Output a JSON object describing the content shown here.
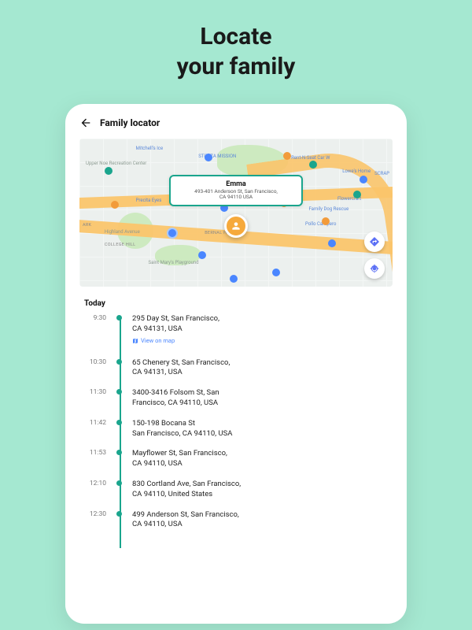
{
  "promo": {
    "line1": "Locate",
    "line2": "your family"
  },
  "header": {
    "title": "Family locator"
  },
  "map": {
    "callout": {
      "name": "Emma",
      "address_line1": "493-401 Anderson St, San Francisco,",
      "address_line2": "CA 94110 USA"
    },
    "labels": {
      "bernal": "BERNAL HEIGHTS",
      "college": "COLLEGE HILL",
      "park_lbl": "ARK",
      "highland": "Highland Avenue",
      "stmarys": "Saint Mary's Playground",
      "mission": "ST(R)ZA MISSION",
      "flowercraft": "Flowercraft",
      "pollo": "Pollo Campero",
      "fdog": "Family Dog Rescue",
      "lowes": "Lowe's Home",
      "scrap": "SCRAP",
      "mitchells": "Mitchell's Ice",
      "precita": "Precita Eyes",
      "upper": "Upper Noe Recreation Center",
      "rsl": "Rent-N-Seat Car W"
    }
  },
  "today_label": "Today",
  "timeline": [
    {
      "time": "9:30",
      "line1": "295 Day St, San Francisco,",
      "line2": "CA 94131, USA",
      "view_on_map": "View on map"
    },
    {
      "time": "10:30",
      "line1": "65 Chenery St, San Francisco,",
      "line2": "CA 94131, USA"
    },
    {
      "time": "11:30",
      "line1": "3400-3416 Folsom St, San",
      "line2": "Francisco, CA 94110, USA"
    },
    {
      "time": "11:42",
      "line1": "150-198 Bocana St",
      "line2": "San Francisco, CA 94110, USA"
    },
    {
      "time": "11:53",
      "line1": "Mayflower St, San Francisco,",
      "line2": "CA 94110, USA"
    },
    {
      "time": "12:10",
      "line1": "830 Cortland Ave, San Francisco,",
      "line2": "CA 94110, United States"
    },
    {
      "time": "12:30",
      "line1": "499 Anderson St, San Francisco,",
      "line2": "CA 94110, USA"
    }
  ]
}
